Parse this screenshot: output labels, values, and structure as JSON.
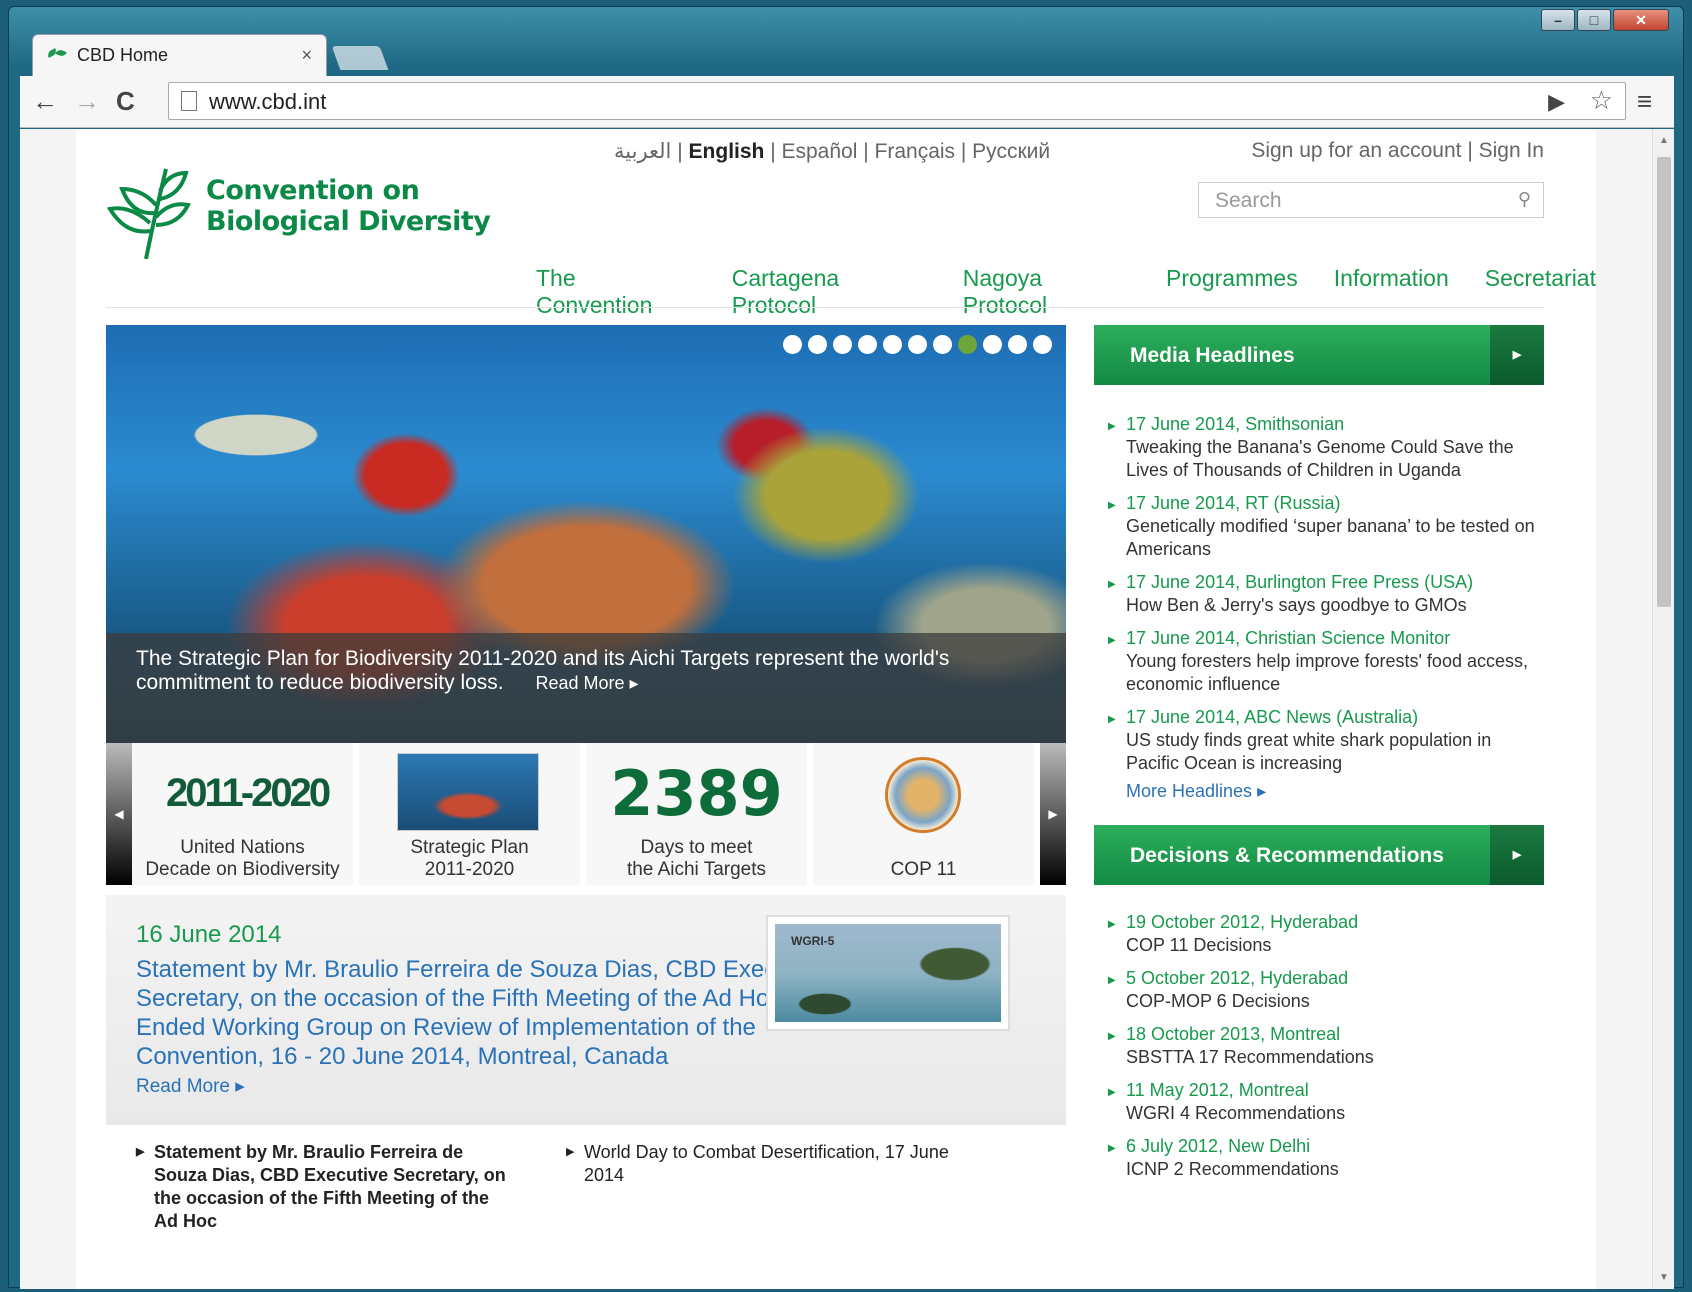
{
  "window": {
    "tab_title": "CBD Home",
    "tab_close": "×",
    "url": "www.cbd.int",
    "controls": {
      "minimize": "–",
      "maximize": "□",
      "close": "✕"
    }
  },
  "browser_icons": {
    "back": "←",
    "forward": "→",
    "reload": "C",
    "bookmark": "☆",
    "menu": "≡",
    "flag": "▶"
  },
  "lang_bar": {
    "arabic": "العربية",
    "english": "English",
    "spanish": "Español",
    "french": "Français",
    "russian": "Русский"
  },
  "account": {
    "signup": "Sign up for an account",
    "signin": "Sign In"
  },
  "logo": {
    "line1": "Convention on",
    "line2": "Biological Diversity"
  },
  "search": {
    "placeholder": "Search"
  },
  "nav": [
    "The Convention",
    "Cartagena Protocol",
    "Nagoya Protocol",
    "Programmes",
    "Information",
    "Secretariat"
  ],
  "hero": {
    "caption": "The Strategic Plan for Biodiversity 2011-2020 and its Aichi Targets represent the world's commitment to reduce biodiversity loss.",
    "read_more": "Read More ▸",
    "slide_count": 11,
    "active_slide": 8
  },
  "carousel": {
    "items": [
      {
        "graphic": "2011-2020",
        "label1": "United Nations",
        "label2": "Decade on Biodiversity"
      },
      {
        "label1": "Strategic Plan",
        "label2": "2011-2020"
      },
      {
        "counter": "2389",
        "label1": "Days to meet",
        "label2": "the Aichi Targets"
      },
      {
        "label1": "",
        "label2": "COP 11"
      }
    ]
  },
  "news": {
    "date": "16 June 2014",
    "title": "Statement by Mr. Braulio Ferreira de Souza Dias, CBD Executive Secretary, on the occasion of the Fifth Meeting of the Ad Hoc Open-Ended Working Group on Review of Implementation of the Convention, 16 - 20 June 2014, Montreal, Canada",
    "read_more": "Read More ▸",
    "image_tag": "WGRI-5",
    "sub_items": [
      "Statement by Mr. Braulio Ferreira de Souza Dias, CBD Executive Secretary, on the occasion of the Fifth Meeting of the Ad Hoc",
      "World Day to Combat Desertification, 17 June 2014"
    ]
  },
  "media": {
    "heading": "Media Headlines",
    "items": [
      {
        "date": "17 June 2014, Smithsonian",
        "text": "Tweaking the Banana's Genome Could Save the Lives of Thousands of Children in Uganda"
      },
      {
        "date": "17 June 2014, RT (Russia)",
        "text": "Genetically modified ‘super banana’ to be tested on Americans"
      },
      {
        "date": "17 June 2014, Burlington Free Press (USA)",
        "text": "How Ben & Jerry's says goodbye to GMOs"
      },
      {
        "date": "17 June 2014, Christian Science Monitor",
        "text": "Young foresters help improve forests' food access, economic influence"
      },
      {
        "date": "17 June 2014, ABC News (Australia)",
        "text": "US study finds great white shark population in Pacific Ocean is increasing"
      }
    ],
    "more": "More Headlines ▸"
  },
  "decisions": {
    "heading": "Decisions & Recommendations",
    "items": [
      {
        "date": "19 October 2012, Hyderabad",
        "text": "COP 11 Decisions"
      },
      {
        "date": "5 October 2012, Hyderabad",
        "text": "COP-MOP 6 Decisions"
      },
      {
        "date": "18 October 2013, Montreal",
        "text": "SBSTTA 17 Recommendations"
      },
      {
        "date": "11 May 2012, Montreal",
        "text": "WGRI 4 Recommendations"
      },
      {
        "date": "6 July 2012, New Delhi",
        "text": "ICNP 2 Recommendations"
      }
    ]
  }
}
